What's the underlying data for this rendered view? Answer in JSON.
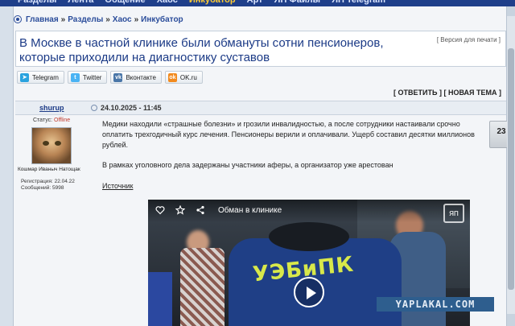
{
  "topnav": {
    "items": [
      "Разделы",
      "Лента",
      "Общение",
      "Хаос",
      "Инкубатор",
      "Арт",
      "ЯП Файлы",
      "ЯП Telegram"
    ]
  },
  "breadcrumb": {
    "items": [
      "Главная",
      "Разделы",
      "Хаос",
      "Инкубатор"
    ],
    "separator": "»"
  },
  "post": {
    "title": "В Москве в частной клинике были обмануты сотни пенсионеров, которые приходили на диагностику суставов",
    "print_version": "[ Версия для печати ]",
    "reply": "[ ОТВЕТИТЬ ]",
    "new_topic": "[ НОВАЯ ТЕМА ]",
    "date": "24.10.2025 - 11:45",
    "rating": "23",
    "paragraphs": [
      "Медики находили «страшные болезни» и грозили инвалидностью, а после сотрудники настаивали срочно оплатить трехгодичный курс лечения. Пенсионеры верили и оплачивали. Ущерб составил десятки миллионов рублей.",
      "В рамках уголовного дела задержаны участники аферы, а организатор уже арестован"
    ],
    "source": "Источник"
  },
  "share": {
    "buttons": [
      {
        "label": "Telegram",
        "icon": "telegram-icon",
        "color": "#2aa3df"
      },
      {
        "label": "Twitter",
        "icon": "twitter-icon",
        "color": "#4ab3f4"
      },
      {
        "label": "Вконтакте",
        "icon": "vk-icon",
        "color": "#4a76a8"
      },
      {
        "label": "OK.ru",
        "icon": "ok-icon",
        "color": "#f28a1e"
      }
    ]
  },
  "author": {
    "username": "shurup",
    "status_label": "Статус:",
    "status_value": "Offline",
    "nickname": "Кошмар Иваныч Натощак",
    "registration": "Регистрация: 22.04.22",
    "messages": "Сообщений: 5998"
  },
  "video": {
    "title": "Обман в клинике",
    "logo": "ЯП",
    "vest_text": "УЭБиПК"
  },
  "watermark": "YAPLAKAL.COM"
}
